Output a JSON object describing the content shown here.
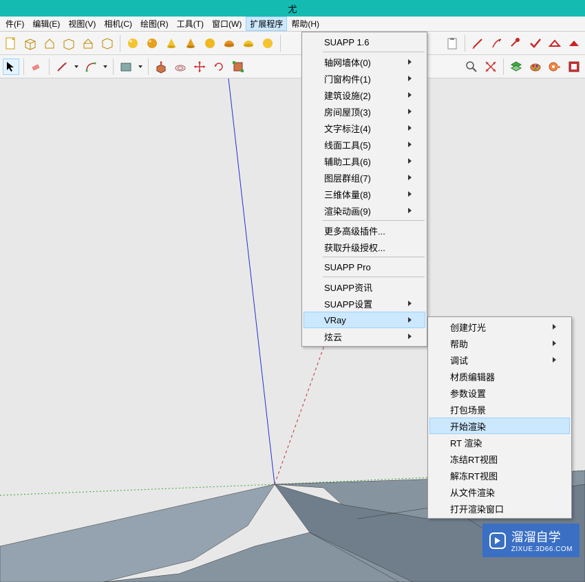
{
  "title_bar": {
    "text": "尤"
  },
  "menubar": {
    "items": [
      {
        "label": "件(F)"
      },
      {
        "label": "编辑(E)"
      },
      {
        "label": "视图(V)"
      },
      {
        "label": "相机(C)"
      },
      {
        "label": "绘图(R)"
      },
      {
        "label": "工具(T)"
      },
      {
        "label": "窗口(W)"
      },
      {
        "label": "扩展程序",
        "active": true
      },
      {
        "label": "帮助(H)"
      }
    ]
  },
  "dropdown1": {
    "items": [
      {
        "label": "SUAPP 1.6"
      },
      {
        "sep": true
      },
      {
        "label": "轴网墙体(0)",
        "submenu": true
      },
      {
        "label": "门窗构件(1)",
        "submenu": true
      },
      {
        "label": "建筑设施(2)",
        "submenu": true
      },
      {
        "label": "房间屋顶(3)",
        "submenu": true
      },
      {
        "label": "文字标注(4)",
        "submenu": true
      },
      {
        "label": "线面工具(5)",
        "submenu": true
      },
      {
        "label": "辅助工具(6)",
        "submenu": true
      },
      {
        "label": "图层群组(7)",
        "submenu": true
      },
      {
        "label": "三维体量(8)",
        "submenu": true
      },
      {
        "label": "渲染动画(9)",
        "submenu": true
      },
      {
        "sep": true
      },
      {
        "label": "更多高级插件..."
      },
      {
        "label": "获取升级授权..."
      },
      {
        "sep": true
      },
      {
        "label": "SUAPP Pro"
      },
      {
        "sep": true
      },
      {
        "label": "SUAPP资讯"
      },
      {
        "label": "SUAPP设置",
        "submenu": true
      },
      {
        "label": "VRay",
        "submenu": true,
        "hovered": true
      },
      {
        "label": "炫云",
        "submenu": true
      }
    ]
  },
  "dropdown2": {
    "items": [
      {
        "label": "创建灯光",
        "submenu": true
      },
      {
        "label": "帮助",
        "submenu": true
      },
      {
        "label": "调试",
        "submenu": true
      },
      {
        "label": "材质编辑器"
      },
      {
        "label": "参数设置"
      },
      {
        "label": "打包场景"
      },
      {
        "label": "开始渲染",
        "hovered": true
      },
      {
        "label": "RT 渲染"
      },
      {
        "label": "冻结RT视图"
      },
      {
        "label": "解冻RT视图"
      },
      {
        "label": "从文件渲染"
      },
      {
        "label": "打开渲染窗口"
      }
    ]
  },
  "watermark": {
    "main": "溜溜自学",
    "sub": "ZIXUE.3D66.COM"
  },
  "icons": {
    "toolbar1": [
      "file",
      "box",
      "house",
      "box2",
      "house2",
      "box3",
      "sep",
      "sphere-yellow",
      "sphere-orange",
      "cone-yellow",
      "cone-orange",
      "sphere-gold",
      "hat-orange",
      "hat-yellow",
      "sphere-yellow2",
      "sep",
      "clipboard"
    ],
    "toolbar1_right": [
      "pencil",
      "check-red",
      "tape-red",
      "check2",
      "roof-red",
      "roof-red2"
    ],
    "toolbar2": [
      "cursor",
      "sep",
      "eraser",
      "sep",
      "pen",
      "dropdown",
      "arc",
      "dropdown",
      "sep",
      "shape",
      "dropdown",
      "sep",
      "pushpull",
      "offset",
      "move",
      "rotate",
      "scale",
      "sep",
      "zoom",
      "zoom-target",
      "pan",
      "sep",
      "layers",
      "paint",
      "tape",
      "comp"
    ]
  }
}
